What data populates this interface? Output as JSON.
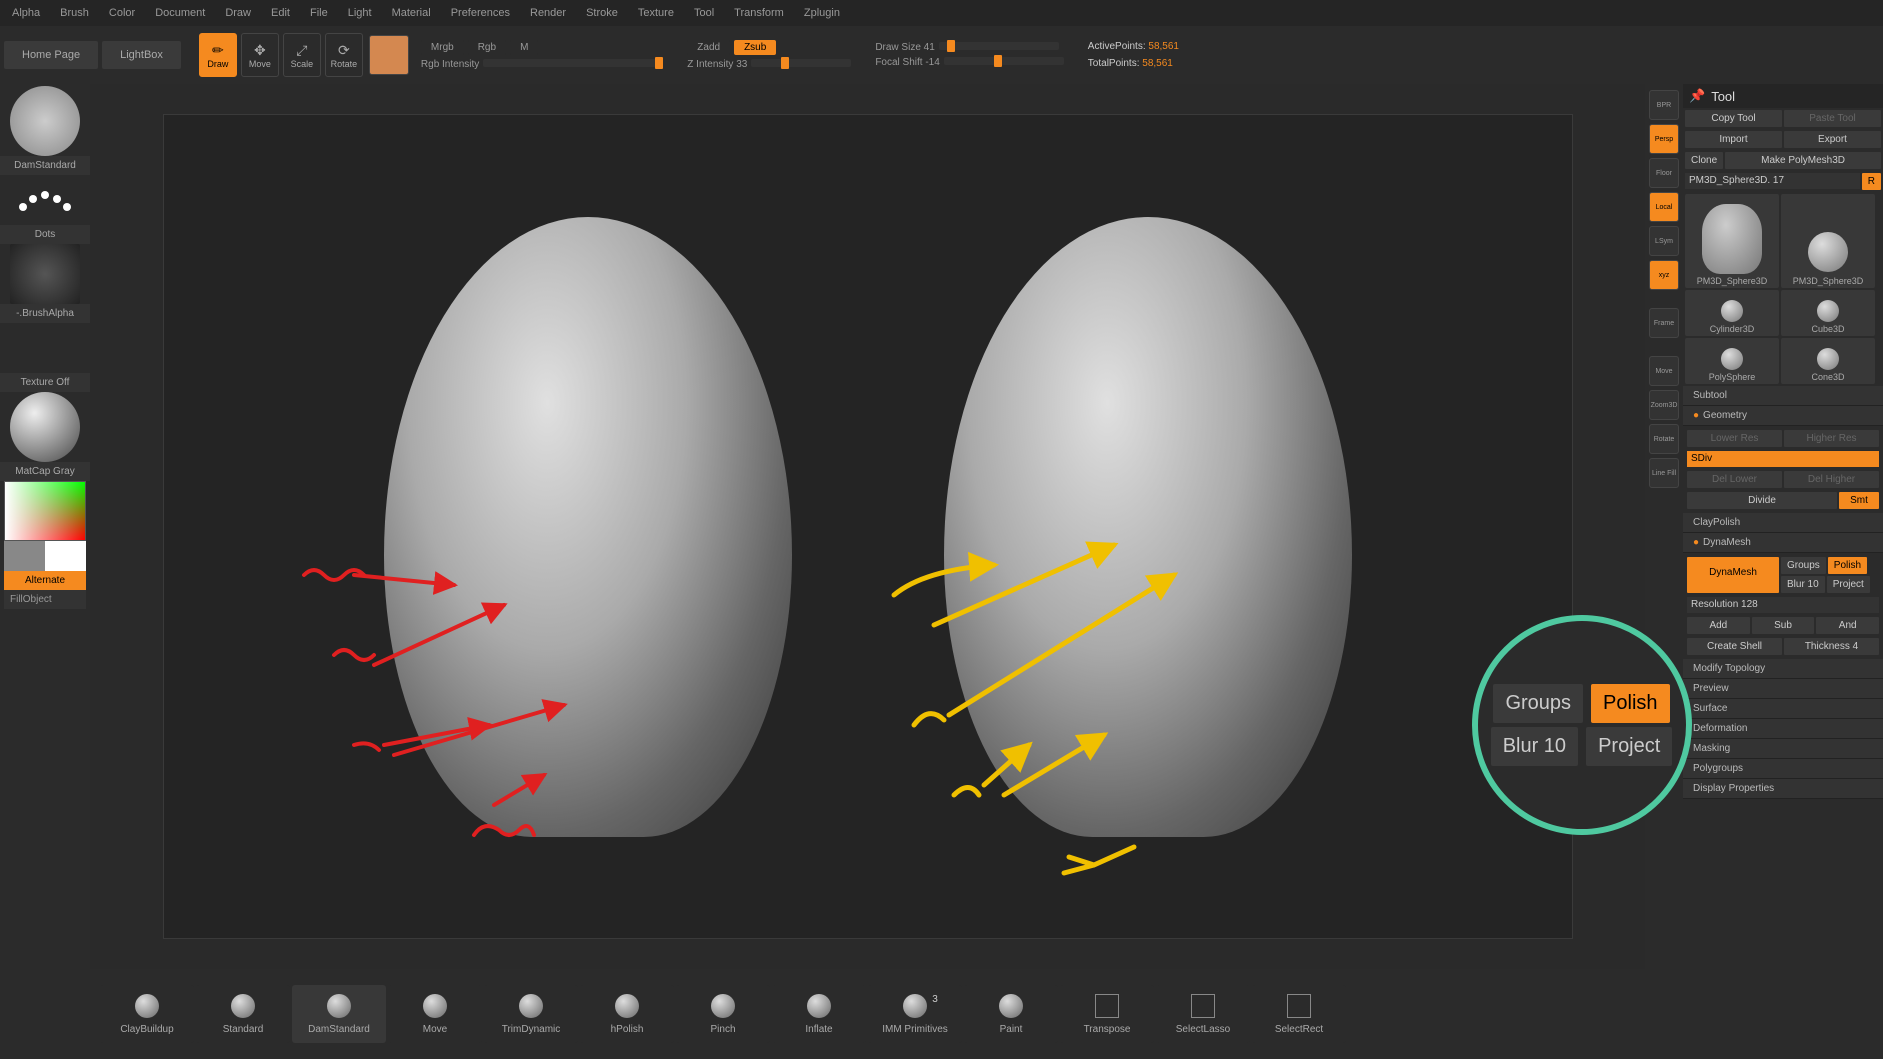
{
  "menubar": [
    "Alpha",
    "Brush",
    "Color",
    "Document",
    "Draw",
    "Edit",
    "File",
    "Light",
    "Material",
    "Preferences",
    "Render",
    "Stroke",
    "Texture",
    "Tool",
    "Transform",
    "Zplugin"
  ],
  "topshelf": {
    "tabs": [
      "Home Page",
      "LightBox"
    ],
    "modes": [
      "Draw",
      "Move",
      "Scale",
      "Rotate"
    ],
    "color_row": [
      "Mrgb",
      "Rgb",
      "M"
    ],
    "rgb_intensity_label": "Rgb Intensity",
    "zi_label": "Z Intensity 33",
    "zadd_row": [
      "Zadd",
      "Zsub"
    ],
    "zsub_active": "Zsub",
    "draw_size_label": "Draw Size 41",
    "focal_shift_label": "Focal Shift -14",
    "stats": {
      "active_label": "ActivePoints:",
      "active_val": " 58,561",
      "total_label": "TotalPoints:",
      "total_val": " 58,561"
    }
  },
  "leftpanel": {
    "brush_name": "DamStandard",
    "stroke_name": "Dots",
    "alpha_name": "-.BrushAlpha",
    "texture_name": "Texture Off",
    "material_name": "MatCap Gray",
    "alternate": "Alternate",
    "fill_object": "FillObject"
  },
  "right_gutter": [
    "BPR",
    "Persp",
    "Floor",
    "Local",
    "LSym",
    "xyz",
    "",
    "Frame",
    "",
    "Move",
    "Zoom3D",
    "Rotate",
    "Line Fill"
  ],
  "right_gutter_active": [
    "Persp",
    "Local",
    "xyz"
  ],
  "rightpanel": {
    "title": "Tool",
    "row1": [
      "Copy Tool",
      "Paste Tool"
    ],
    "row2": [
      "Import",
      "Export"
    ],
    "row3": [
      "Clone",
      "Make PolyMesh3D"
    ],
    "current": "PM3D_Sphere3D. 17",
    "r_btn": "R",
    "tools": [
      "PM3D_Sphere3D",
      "PM3D_Sphere3D",
      "Cylinder3D",
      "Cube3D",
      "PolySphere",
      "Cone3D"
    ],
    "sections": {
      "subtool": "Subtool",
      "geometry": "Geometry",
      "geom_rows": {
        "lower_res": "Lower Res",
        "higher_res": "Higher Res",
        "sdiv": "SDiv",
        "del_lower": "Del Lower",
        "del_higher": "Del Higher",
        "divide": "Divide",
        "smt": "Smt"
      },
      "claypolish": "ClayPolish",
      "dynamesh": "DynaMesh",
      "dyna_rows": {
        "dynamesh": "DynaMesh",
        "groups": "Groups",
        "polish": "Polish",
        "blur": "Blur 10",
        "project": "Project",
        "resolution": "Resolution 128",
        "add": "Add",
        "sub": "Sub",
        "and": "And",
        "create_shell": "Create Shell",
        "thickness": "Thickness 4"
      },
      "modify_topology": "Modify Topology",
      "others": [
        "Preview",
        "Surface",
        "Deformation",
        "Masking",
        "Polygroups",
        "Display Properties"
      ]
    }
  },
  "callout": {
    "groups": "Groups",
    "polish": "Polish",
    "blur": "Blur 10",
    "project": "Project"
  },
  "bottom": [
    {
      "label": "ClayBuildup"
    },
    {
      "label": "Standard"
    },
    {
      "label": "DamStandard",
      "active": true
    },
    {
      "label": "Move"
    },
    {
      "label": "TrimDynamic"
    },
    {
      "label": "hPolish"
    },
    {
      "label": "Pinch"
    },
    {
      "label": "Inflate"
    },
    {
      "label": "IMM Primitives",
      "badge": "3"
    },
    {
      "label": "Paint"
    },
    {
      "label": "Transpose",
      "flat": true
    },
    {
      "label": "SelectLasso",
      "flat": true
    },
    {
      "label": "SelectRect",
      "flat": true
    }
  ],
  "chart_data": {
    "type": "table",
    "note": "3D sculpting software screenshot with two head model views annotated in red (left, before) and yellow (right, after) arrows indicating surface smoothing via DynaMesh Polish.",
    "settings": {
      "DrawSize": 41,
      "ZIntensity": 33,
      "FocalShift": -14,
      "ActivePoints": 58561,
      "TotalPoints": 58561,
      "DynaMesh": {
        "Blur": 10,
        "Resolution": 128,
        "Polish": true,
        "Groups": false,
        "Project": false,
        "Thickness": 4
      }
    }
  }
}
